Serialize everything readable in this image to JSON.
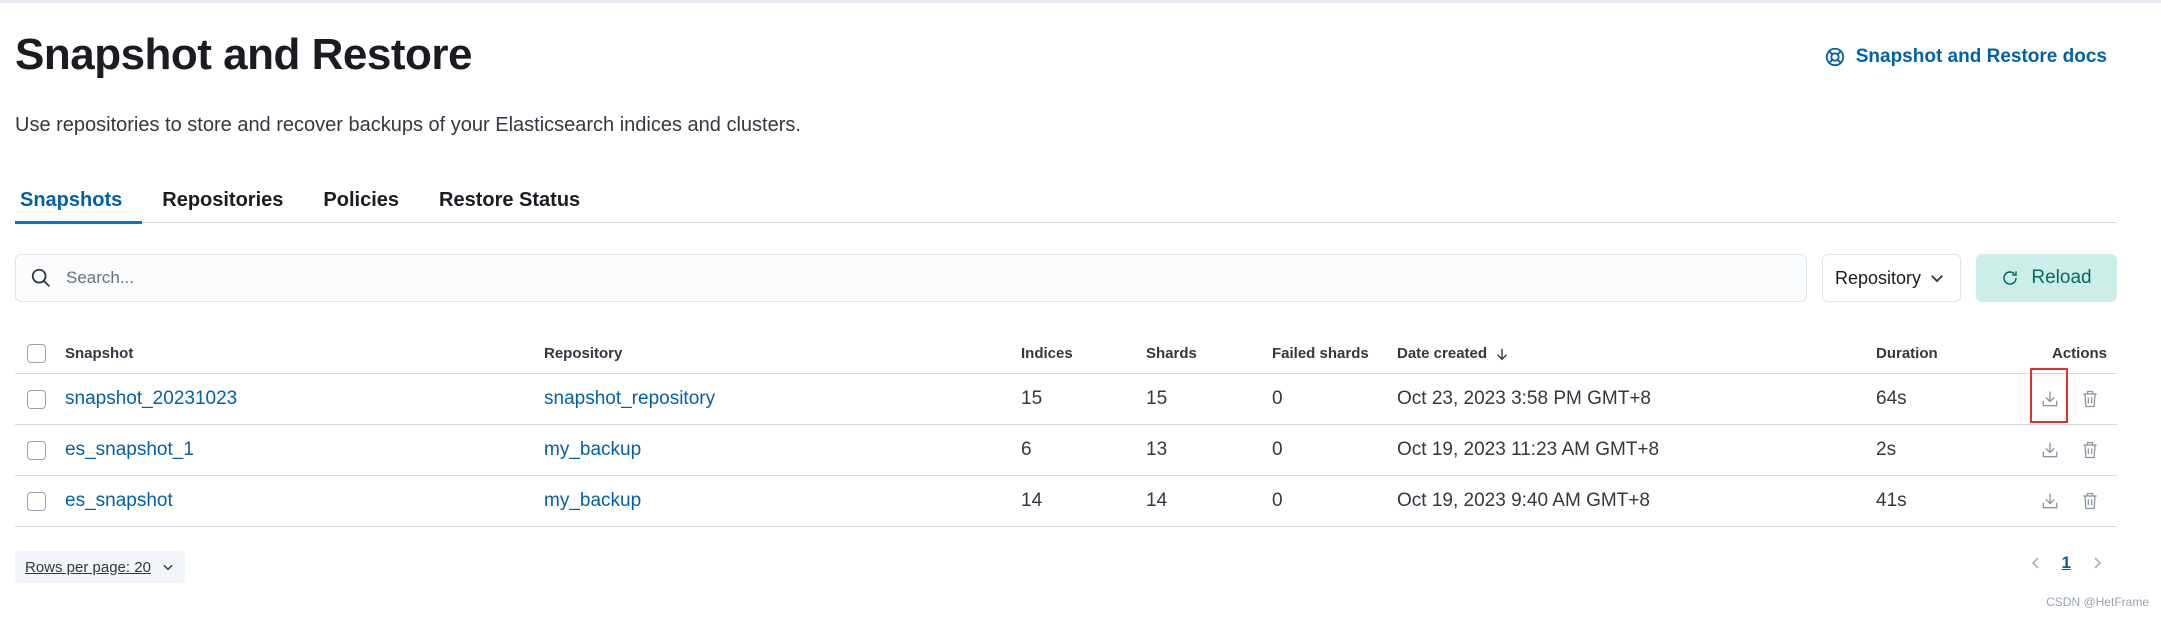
{
  "header": {
    "title": "Snapshot and Restore",
    "docs_link": "Snapshot and Restore docs",
    "subtitle": "Use repositories to store and recover backups of your Elasticsearch indices and clusters."
  },
  "tabs": [
    {
      "label": "Snapshots",
      "active": true
    },
    {
      "label": "Repositories",
      "active": false
    },
    {
      "label": "Policies",
      "active": false
    },
    {
      "label": "Restore Status",
      "active": false
    }
  ],
  "toolbar": {
    "search_placeholder": "Search...",
    "repository_filter": "Repository",
    "reload_label": "Reload"
  },
  "table": {
    "columns": {
      "snapshot": "Snapshot",
      "repository": "Repository",
      "indices": "Indices",
      "shards": "Shards",
      "failed_shards": "Failed shards",
      "date_created": "Date created",
      "duration": "Duration",
      "actions": "Actions"
    },
    "rows": [
      {
        "snapshot": "snapshot_20231023",
        "repository": "snapshot_repository",
        "indices": "15",
        "shards": "15",
        "failed_shards": "0",
        "date_created": "Oct 23, 2023 3:58 PM GMT+8",
        "duration": "64s"
      },
      {
        "snapshot": "es_snapshot_1",
        "repository": "my_backup",
        "indices": "6",
        "shards": "13",
        "failed_shards": "0",
        "date_created": "Oct 19, 2023 11:23 AM GMT+8",
        "duration": "2s"
      },
      {
        "snapshot": "es_snapshot",
        "repository": "my_backup",
        "indices": "14",
        "shards": "14",
        "failed_shards": "0",
        "date_created": "Oct 19, 2023 9:40 AM GMT+8",
        "duration": "41s"
      }
    ]
  },
  "footer": {
    "rows_per_page": "Rows per page: 20",
    "current_page": "1"
  },
  "watermark": "CSDN @HetFrame",
  "colors": {
    "link": "#0061a6",
    "tab_active_underline": "#0077cc",
    "reload_bg": "#cceee9",
    "reload_text": "#006b5f",
    "highlight": "#e03131"
  }
}
